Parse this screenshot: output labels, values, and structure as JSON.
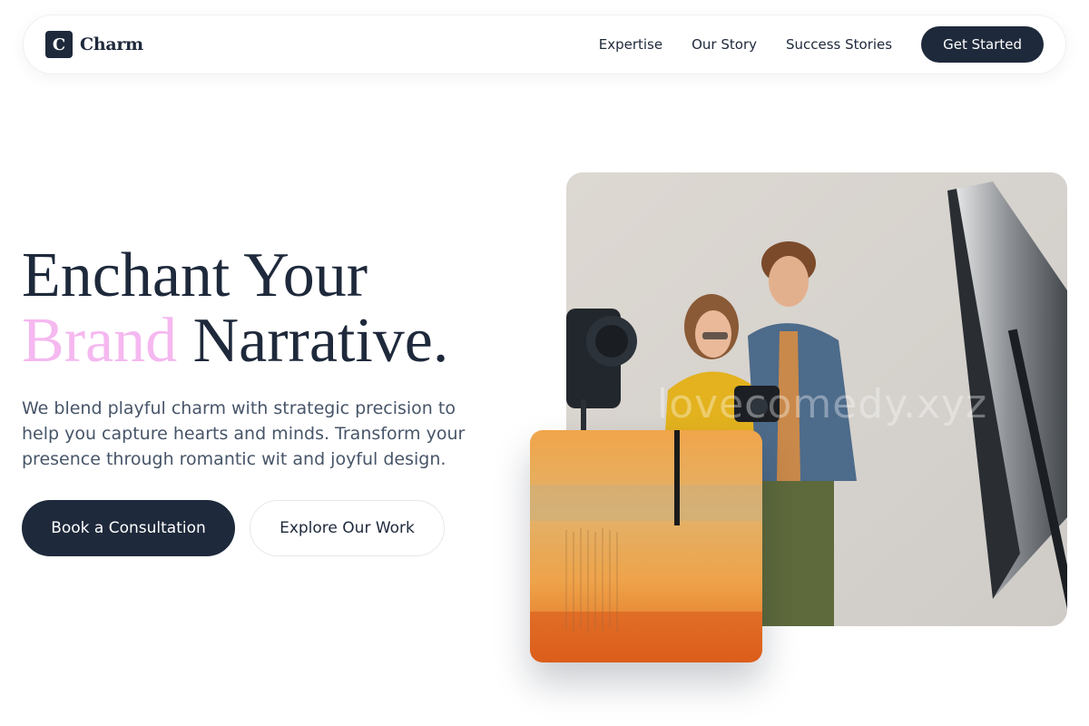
{
  "brand": {
    "mark": "C",
    "name": "Charm"
  },
  "nav": {
    "links": [
      "Expertise",
      "Our Story",
      "Success Stories"
    ],
    "cta": "Get Started"
  },
  "hero": {
    "title_line1": "Enchant Your",
    "title_accent": "Brand",
    "title_rest": "Narrative.",
    "description": "We blend playful charm with strategic precision to help you capture hearts and minds. Transform your presence through romantic wit and joyful design.",
    "primary_button": "Book a Consultation",
    "secondary_button": "Explore Our Work"
  },
  "images": {
    "main_watermark": "lovecomedy.xyz"
  },
  "colors": {
    "primary": "#1e293b",
    "accent": "#f5b8f0",
    "text_muted": "#475569"
  }
}
